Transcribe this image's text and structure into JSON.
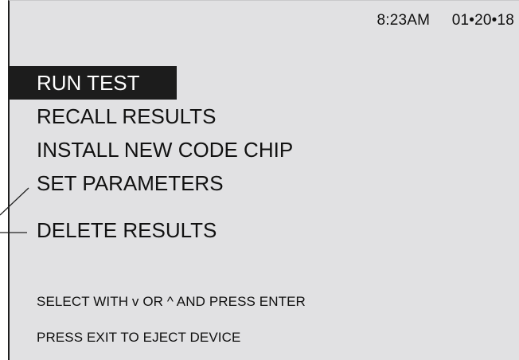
{
  "status": {
    "time": "8:23AM",
    "date": "01•20•18"
  },
  "menu": {
    "items": [
      {
        "label": "RUN TEST",
        "selected": true
      },
      {
        "label": "RECALL RESULTS",
        "selected": false
      },
      {
        "label": "INSTALL NEW CODE CHIP",
        "selected": false
      },
      {
        "label": "SET PARAMETERS",
        "selected": false
      },
      {
        "label": "DELETE RESULTS",
        "selected": false
      }
    ]
  },
  "instructions": {
    "select": "SELECT WITH v OR ^ AND PRESS ENTER",
    "exit": "PRESS EXIT TO EJECT DEVICE"
  }
}
